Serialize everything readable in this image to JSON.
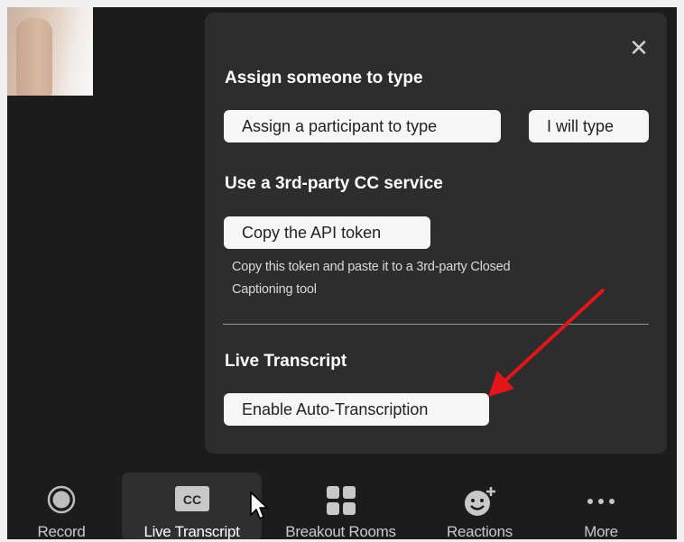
{
  "panel": {
    "close_glyph": "✕",
    "assign_section": {
      "title": "Assign someone to type",
      "assign_button": "Assign a participant to type",
      "self_button": "I will type"
    },
    "third_party_section": {
      "title": "Use a 3rd-party CC service",
      "copy_button": "Copy the API token",
      "hint_line1": "Copy this token and paste it to a 3rd-party Closed",
      "hint_line2": "Captioning tool"
    },
    "live_section": {
      "title": "Live Transcript",
      "enable_button": "Enable Auto-Transcription"
    }
  },
  "toolbar": {
    "record": "Record",
    "live_transcript": "Live Transcript",
    "cc_badge": "CC",
    "breakout_rooms": "Breakout Rooms",
    "reactions": "Reactions",
    "more": "More"
  },
  "colors": {
    "background": "#1c1c1c",
    "panel": "#2d2d2d",
    "button": "#f6f6f6",
    "annotation_arrow": "#e0161b"
  }
}
